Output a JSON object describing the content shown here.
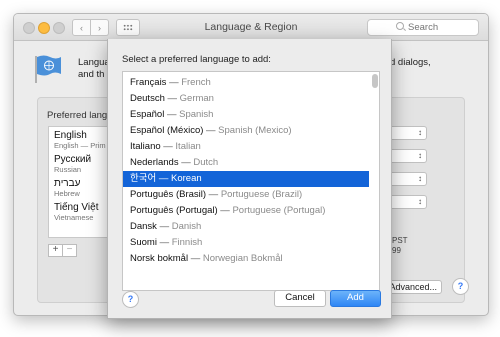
{
  "window": {
    "title": "Language & Region",
    "search_placeholder": "Search",
    "intro_line1": "Langua",
    "intro_line2": "and th",
    "intro_right": "d dialogs,"
  },
  "preferred": {
    "label": "Preferred langu",
    "items": [
      {
        "name": "English",
        "sub": "English — Prim"
      },
      {
        "name": "Русский",
        "sub": "Russian"
      },
      {
        "name": "עברית",
        "sub": "Hebrew"
      },
      {
        "name": "Tiếng Việt",
        "sub": "Vietnamese"
      }
    ],
    "plus": "+",
    "minus": "−"
  },
  "right_panel": {
    "pst_text": "PST",
    "num_text": "99",
    "advanced_label": "Advanced..."
  },
  "sheet": {
    "prompt": "Select a preferred language to add:",
    "languages": [
      {
        "native": "Français",
        "english": "French"
      },
      {
        "native": "Deutsch",
        "english": "German"
      },
      {
        "native": "Español",
        "english": "Spanish"
      },
      {
        "native": "Español (México)",
        "english": "Spanish (Mexico)"
      },
      {
        "native": "Italiano",
        "english": "Italian"
      },
      {
        "native": "Nederlands",
        "english": "Dutch"
      },
      {
        "native": "한국어",
        "english": "Korean"
      },
      {
        "native": "Português (Brasil)",
        "english": "Portuguese (Brazil)"
      },
      {
        "native": "Português (Portugal)",
        "english": "Portuguese (Portugal)"
      },
      {
        "native": "Dansk",
        "english": "Danish"
      },
      {
        "native": "Suomi",
        "english": "Finnish"
      },
      {
        "native": "Norsk bokmål",
        "english": "Norwegian Bokmål"
      }
    ],
    "selected_index": 6,
    "cancel_label": "Cancel",
    "add_label": "Add",
    "help_label": "?"
  },
  "colors": {
    "selection": "#1364d8",
    "accent": "#3478f6"
  }
}
